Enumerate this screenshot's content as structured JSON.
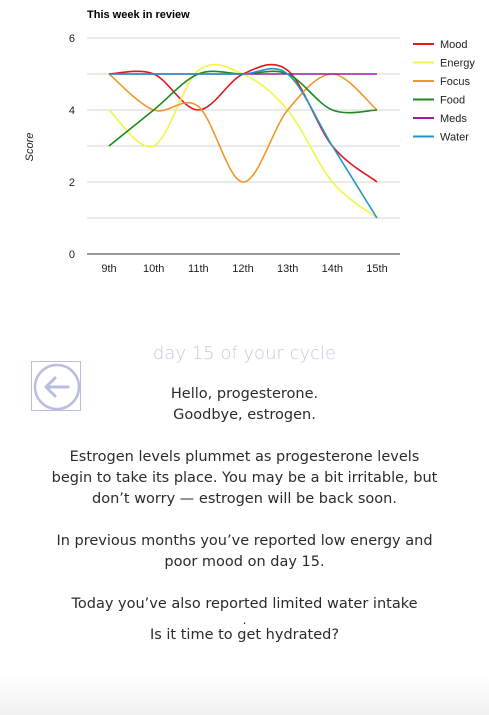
{
  "chart_data": {
    "type": "line",
    "title": "This week in review",
    "ylabel": "Score",
    "xlabel": "",
    "categories": [
      "9th",
      "10th",
      "11th",
      "12th",
      "13th",
      "14th",
      "15th"
    ],
    "ylim": [
      0,
      6
    ],
    "yticks": [
      0,
      2,
      4,
      6
    ],
    "grid": true,
    "legend_position": "right",
    "series": [
      {
        "name": "Mood",
        "color": "#e0191f",
        "values": [
          5,
          5,
          4,
          5,
          5.1,
          3,
          2
        ]
      },
      {
        "name": "Energy",
        "color": "#f4f447",
        "values": [
          4,
          3,
          5.1,
          5,
          4,
          2,
          1
        ]
      },
      {
        "name": "Focus",
        "color": "#f0972a",
        "values": [
          5,
          4,
          4.1,
          2,
          4,
          5,
          4
        ]
      },
      {
        "name": "Food",
        "color": "#1d8b1d",
        "values": [
          3,
          4,
          5,
          5,
          5,
          4,
          4
        ]
      },
      {
        "name": "Meds",
        "color": "#9b1ba6",
        "values": [
          5,
          5,
          5,
          5,
          5,
          5,
          5
        ]
      },
      {
        "name": "Water",
        "color": "#2596c8",
        "values": [
          5,
          5,
          5,
          5,
          5,
          3,
          1
        ]
      }
    ]
  },
  "back_icon": "arrow-left-icon",
  "day_label": "day 15 of your cycle",
  "message": {
    "greeting_line1": "Hello, progesterone.",
    "greeting_line2": "Goodbye, estrogen.",
    "para1_line1": "Estrogen levels plummet as progesterone levels",
    "para1_line2": "begin to take its place. You may be a bit irritable, but",
    "para1_line3": "don’t worry — estrogen will be back soon.",
    "para2_line1": "In previous months you’ve reported low energy and",
    "para2_line2": "poor mood on day 15.",
    "para3_line1": "Today you’ve also reported limited water intake",
    "para3_dot": ".",
    "para3_line2": "Is it time to get hydrated?"
  },
  "colors": {
    "accent": "#b9bde0",
    "day_label": "#c4c8e8"
  }
}
